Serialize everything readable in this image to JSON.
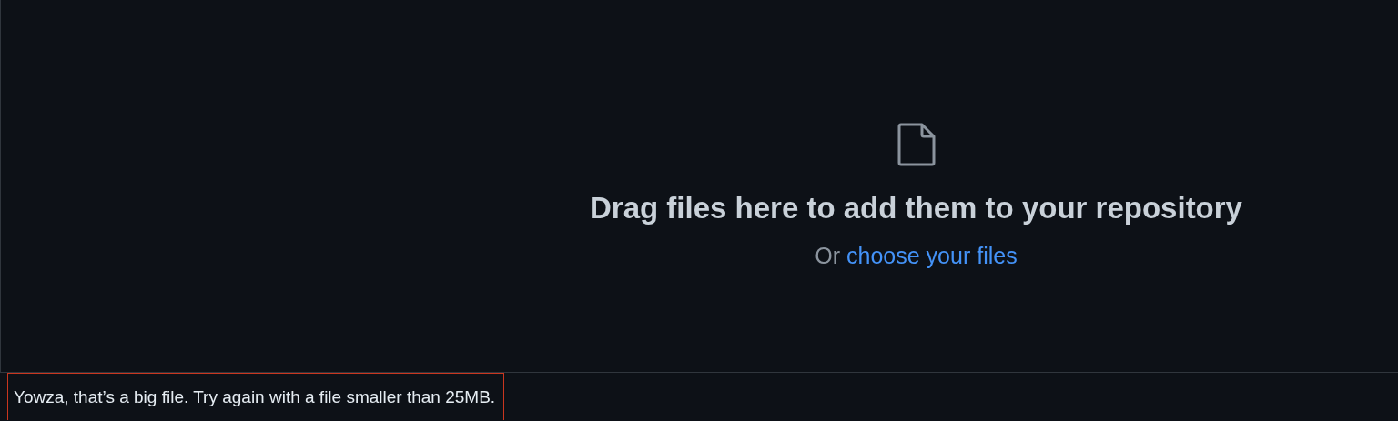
{
  "dropzone": {
    "heading": "Drag files here to add them to your repository",
    "prompt": "Or",
    "link": "choose your files"
  },
  "error": {
    "message": "Yowza, that’s a big file. Try again with a file smaller than 25MB."
  }
}
